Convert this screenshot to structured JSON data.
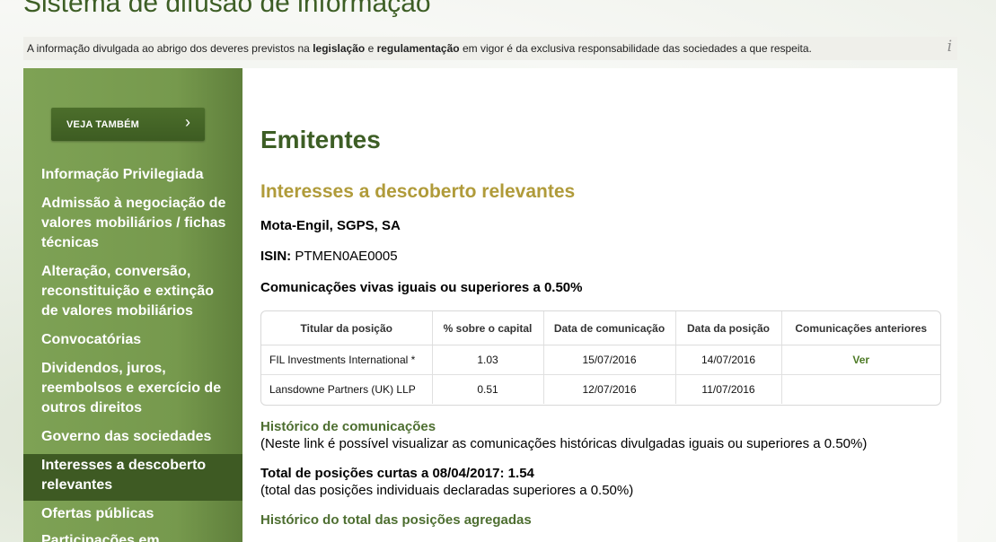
{
  "site": {
    "title": "Sistema de difusão de informação"
  },
  "notice": {
    "part1": "A informação divulgada ao abrigo dos deveres previstos na ",
    "legislacao": "legislação",
    "part2": " e ",
    "regulamentacao": "regulamentação",
    "part3": " em vigor é da exclusiva responsabilidade das sociedades a que respeita.",
    "info_icon": "i"
  },
  "sidebar": {
    "see_also_label": "VEJA TAMBÉM",
    "see_also_chevron": "›",
    "items": [
      {
        "label": "Informação Privilegiada"
      },
      {
        "label": "Admissão à negociação de valores mobiliários / fichas técnicas"
      },
      {
        "label": "Alteração, conversão, reconstituição e extinção de valores mobiliários"
      },
      {
        "label": "Convocatórias"
      },
      {
        "label": "Dividendos, juros, reembolsos e exercício de outros direitos"
      },
      {
        "label": "Governo das sociedades"
      },
      {
        "label": "Interesses a descoberto relevantes",
        "active": true
      },
      {
        "label": "Ofertas públicas"
      },
      {
        "label": "Participações em"
      }
    ]
  },
  "main": {
    "title": "Emitentes",
    "subtitle": "Interesses a descoberto relevantes",
    "company": "Mota-Engil, SGPS, SA",
    "isin_label": "ISIN:",
    "isin_value": " PTMEN0AE0005",
    "comms_heading": "Comunicações vivas iguais ou superiores a 0.50%",
    "table": {
      "headers": [
        "Titular da posição",
        "% sobre o capital",
        "Data de comunicação",
        "Data da posição",
        "Comunicações anteriores"
      ],
      "rows": [
        {
          "holder": "FIL Investments International *",
          "pct": "1.03",
          "comm_date": "15/07/2016",
          "pos_date": "14/07/2016",
          "previous": "Ver"
        },
        {
          "holder": "Lansdowne Partners (UK) LLP",
          "pct": "0.51",
          "comm_date": "12/07/2016",
          "pos_date": "11/07/2016",
          "previous": ""
        }
      ]
    },
    "history_link": "Histórico de comunicações",
    "history_note": "(Neste link é possível visualizar as comunicações históricas divulgadas iguais ou superiores a 0.50%)",
    "total": "Total de posições curtas a 08/04/2017: 1.54",
    "total_note": "(total das posições individuais declaradas superiores a 0.50%)",
    "aggregate_link": "Histórico do total das posições agregadas"
  },
  "colors": {
    "brand_green": "#3d5e25",
    "sidebar_green": "#7ea255",
    "active_item": "#3e5a23",
    "subtitle_gold": "#b09b3a",
    "link_green": "#4d7a25"
  }
}
